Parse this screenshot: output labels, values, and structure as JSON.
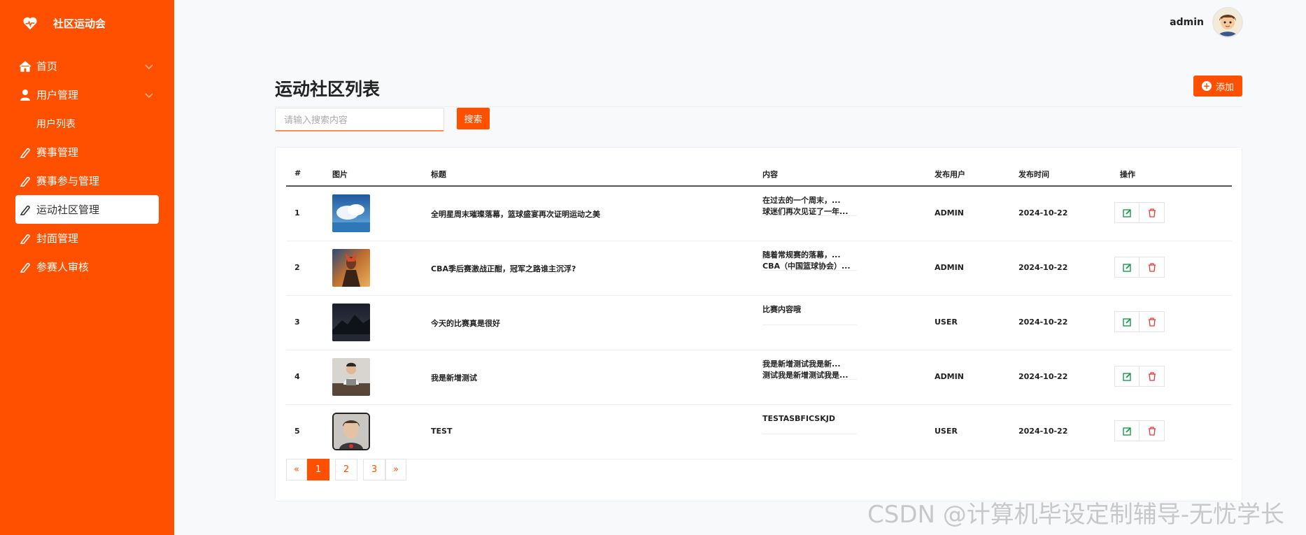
{
  "app": {
    "title": "社区运动会"
  },
  "sidebar": {
    "items": [
      {
        "label": "首页",
        "icon": "home-icon"
      },
      {
        "label": "用户管理",
        "icon": "user-icon"
      },
      {
        "label": "用户列表"
      },
      {
        "label": "赛事管理",
        "icon": "pencil-icon"
      },
      {
        "label": "赛事参与管理",
        "icon": "pencil-icon"
      },
      {
        "label": "运动社区管理",
        "icon": "pencil-icon"
      },
      {
        "label": "封面管理",
        "icon": "pencil-icon"
      },
      {
        "label": "参赛人审核",
        "icon": "pencil-icon"
      }
    ]
  },
  "header": {
    "username": "admin"
  },
  "main": {
    "title": "运动社区列表",
    "add_label": "添加",
    "search": {
      "placeholder": "请输入搜索内容",
      "button": "搜索"
    },
    "table": {
      "columns": [
        "#",
        "图片",
        "标题",
        "内容",
        "发布用户",
        "发布时间",
        "操作"
      ],
      "rows": [
        {
          "index": "1",
          "thumb": "sky-clouds",
          "title": "全明星周末璀璨落幕，篮球盛宴再次证明运动之美",
          "content": "在过去的一个周末，...\n球迷们再次见证了一年...",
          "user": "ADMIN",
          "date": "2024-10-22"
        },
        {
          "index": "2",
          "thumb": "warrior-art",
          "title": "CBA季后赛激战正酣，冠军之路谁主沉浮?",
          "content": "随着常规赛的落幕，...\nCBA（中国篮球协会）...",
          "user": "ADMIN",
          "date": "2024-10-22"
        },
        {
          "index": "3",
          "thumb": "dark-mountains",
          "title": "今天的比赛真是很好",
          "content": "比赛内容哦",
          "user": "USER",
          "date": "2024-10-22"
        },
        {
          "index": "4",
          "thumb": "person-at-desk",
          "title": "我是新增测试",
          "content": "我是新增测试我是新...\n测试我是新增测试我是...",
          "user": "ADMIN",
          "date": "2024-10-22"
        },
        {
          "index": "5",
          "thumb": "portrait-photo",
          "title": "TEST",
          "content": "TESTASBFICSKJD",
          "user": "USER",
          "date": "2024-10-22"
        }
      ]
    },
    "pagination": {
      "prev": "«",
      "pages": [
        "1",
        "2",
        "3"
      ],
      "active": "1",
      "next": "»"
    }
  },
  "colors": {
    "accent": "#ff5000",
    "edit": "#1a9a4a",
    "delete": "#e23b3b"
  },
  "watermark": "CSDN @计算机毕设定制辅导-无忧学长"
}
